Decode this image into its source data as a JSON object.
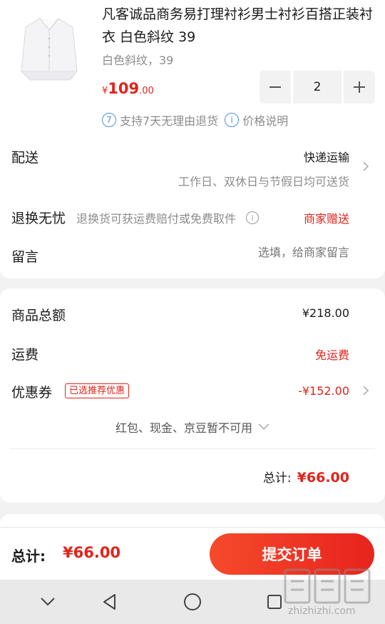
{
  "product": {
    "name": "凡客诚品商务易打理衬衫男士衬衫百搭正装衬衣 白色斜纹 39",
    "spec": "白色斜纹，39",
    "price_symbol": "¥",
    "price_int": "109",
    "price_dec": ".00",
    "quantity": "2",
    "service_badge_num": "7",
    "service_return": "支持7天无理由退货",
    "service_price_note": "价格说明",
    "info_icon_glyph": "i"
  },
  "delivery": {
    "label": "配送",
    "method": "快递运输",
    "note": "工作日、双休日与节假日均可送货"
  },
  "returns": {
    "label": "退换无忧",
    "desc": "退换货可获运费赔付或免费取件",
    "gift": "商家赠送"
  },
  "message": {
    "label": "留言",
    "placeholder": "选填，给商家留言"
  },
  "summary": {
    "goods_total_label": "商品总额",
    "goods_total": "¥218.00",
    "shipping_label": "运费",
    "shipping_value": "免运费",
    "coupon_label": "优惠券",
    "coupon_tag": "已选推荐优惠",
    "coupon_value": "-¥152.00",
    "unavailable": "红包、现金、京豆暂不可用",
    "total_label": "总计:",
    "total_value": "¥66.00"
  },
  "bottom_bar": {
    "total_label": "总计:",
    "total_value": "¥66.00",
    "submit_label": "提交订单"
  },
  "watermark": {
    "site": "zhizhizhi.com"
  },
  "colors": {
    "accent_red": "#e2231a",
    "link_blue": "#4a90e2",
    "gray_text": "#8c8c8c"
  }
}
